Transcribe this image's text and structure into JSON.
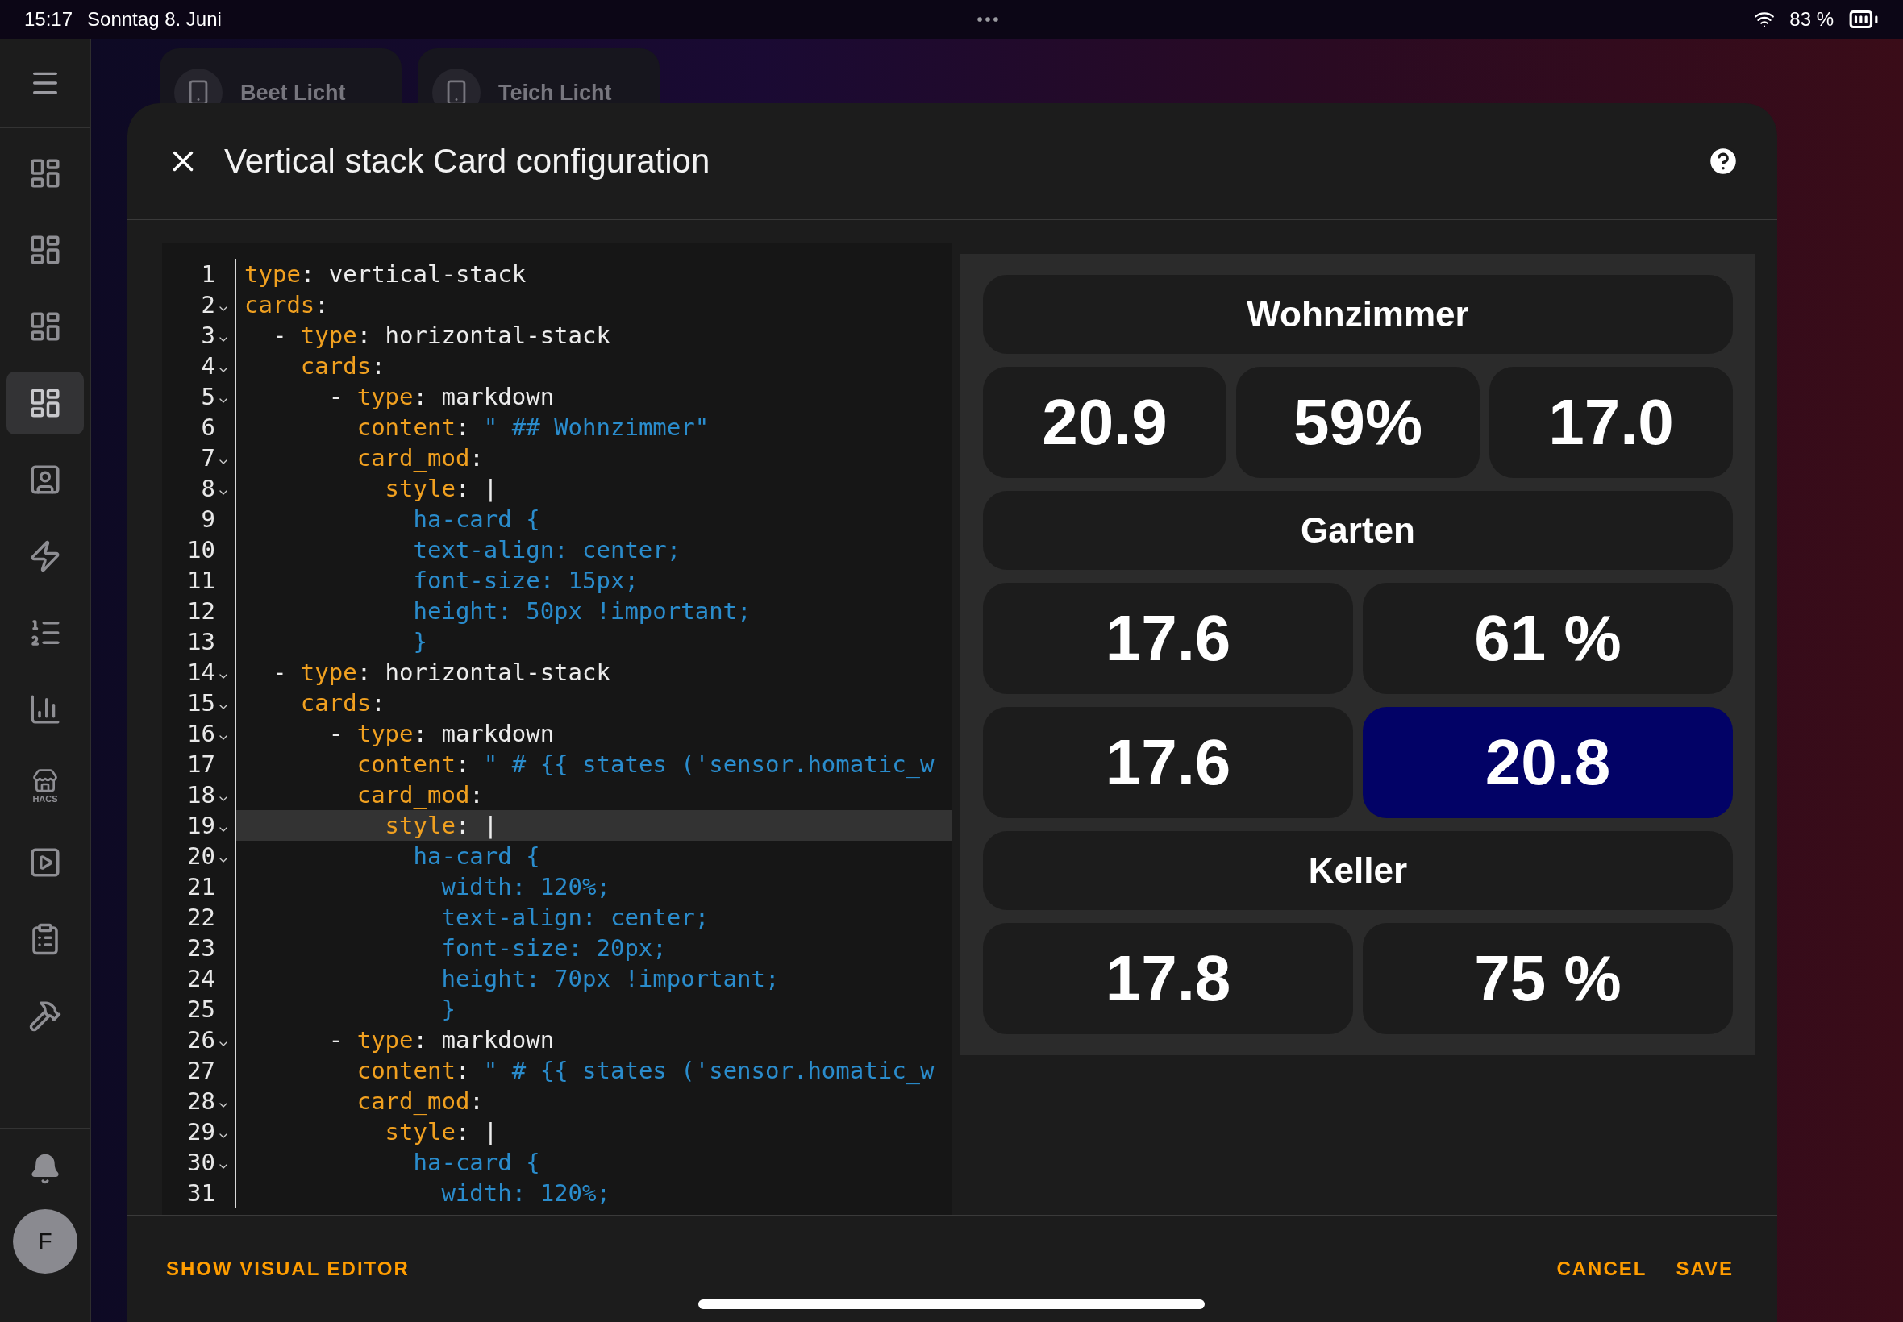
{
  "status_bar": {
    "time": "15:17",
    "date": "Sonntag 8. Juni",
    "battery": "83 %"
  },
  "sidebar": {
    "items": [
      {
        "selected": false
      },
      {
        "selected": false
      },
      {
        "selected": false
      },
      {
        "selected": true
      },
      {
        "selected": false
      },
      {
        "selected": false
      },
      {
        "selected": false
      },
      {
        "selected": false
      },
      {
        "selected": false,
        "label": "HACS"
      },
      {
        "selected": false
      },
      {
        "selected": false
      },
      {
        "selected": false
      }
    ],
    "avatar": "F"
  },
  "background": {
    "tiles": [
      {
        "label": "Beet Licht"
      },
      {
        "label": "Teich Licht"
      }
    ]
  },
  "dialog": {
    "title": "Vertical stack Card configuration",
    "editor": {
      "lines": [
        {
          "number": "1",
          "fold": false,
          "active": false,
          "tokens": [
            {
              "kind": "key",
              "text": "type"
            },
            {
              "kind": "plain",
              "text": ": vertical-stack"
            }
          ]
        },
        {
          "number": "2",
          "fold": true,
          "active": false,
          "tokens": [
            {
              "kind": "key",
              "text": "cards"
            },
            {
              "kind": "plain",
              "text": ":"
            }
          ]
        },
        {
          "number": "3",
          "fold": true,
          "active": false,
          "tokens": [
            {
              "kind": "plain",
              "text": "  - "
            },
            {
              "kind": "key",
              "text": "type"
            },
            {
              "kind": "plain",
              "text": ": horizontal-stack"
            }
          ]
        },
        {
          "number": "4",
          "fold": true,
          "active": false,
          "tokens": [
            {
              "kind": "key",
              "text": "    cards"
            },
            {
              "kind": "plain",
              "text": ":"
            }
          ]
        },
        {
          "number": "5",
          "fold": true,
          "active": false,
          "tokens": [
            {
              "kind": "plain",
              "text": "      - "
            },
            {
              "kind": "key",
              "text": "type"
            },
            {
              "kind": "plain",
              "text": ": markdown"
            }
          ]
        },
        {
          "number": "6",
          "fold": false,
          "active": false,
          "tokens": [
            {
              "kind": "key",
              "text": "        content"
            },
            {
              "kind": "plain",
              "text": ": "
            },
            {
              "kind": "string",
              "text": "\" ## Wohnzimmer\""
            }
          ]
        },
        {
          "number": "7",
          "fold": true,
          "active": false,
          "tokens": [
            {
              "kind": "key",
              "text": "        card_mod"
            },
            {
              "kind": "plain",
              "text": ":"
            }
          ]
        },
        {
          "number": "8",
          "fold": true,
          "active": false,
          "tokens": [
            {
              "kind": "key",
              "text": "          style"
            },
            {
              "kind": "plain",
              "text": ": |"
            }
          ]
        },
        {
          "number": "9",
          "fold": false,
          "active": false,
          "tokens": [
            {
              "kind": "string",
              "text": "            ha-card {"
            }
          ]
        },
        {
          "number": "10",
          "fold": false,
          "active": false,
          "tokens": [
            {
              "kind": "string",
              "text": "            text-align: center;"
            }
          ]
        },
        {
          "number": "11",
          "fold": false,
          "active": false,
          "tokens": [
            {
              "kind": "string",
              "text": "            font-size: 15px;"
            }
          ]
        },
        {
          "number": "12",
          "fold": false,
          "active": false,
          "tokens": [
            {
              "kind": "string",
              "text": "            height: 50px !important;"
            }
          ]
        },
        {
          "number": "13",
          "fold": false,
          "active": false,
          "tokens": [
            {
              "kind": "string",
              "text": "            }"
            }
          ]
        },
        {
          "number": "14",
          "fold": true,
          "active": false,
          "tokens": [
            {
              "kind": "plain",
              "text": "  - "
            },
            {
              "kind": "key",
              "text": "type"
            },
            {
              "kind": "plain",
              "text": ": horizontal-stack"
            }
          ]
        },
        {
          "number": "15",
          "fold": true,
          "active": false,
          "tokens": [
            {
              "kind": "key",
              "text": "    cards"
            },
            {
              "kind": "plain",
              "text": ":"
            }
          ]
        },
        {
          "number": "16",
          "fold": true,
          "active": false,
          "tokens": [
            {
              "kind": "plain",
              "text": "      - "
            },
            {
              "kind": "key",
              "text": "type"
            },
            {
              "kind": "plain",
              "text": ": markdown"
            }
          ]
        },
        {
          "number": "17",
          "fold": false,
          "active": false,
          "tokens": [
            {
              "kind": "key",
              "text": "        content"
            },
            {
              "kind": "plain",
              "text": ": "
            },
            {
              "kind": "string",
              "text": "\" # {{ states ('sensor.homatic_w"
            }
          ]
        },
        {
          "number": "18",
          "fold": true,
          "active": false,
          "tokens": [
            {
              "kind": "key",
              "text": "        card_mod"
            },
            {
              "kind": "plain",
              "text": ":"
            }
          ]
        },
        {
          "number": "19",
          "fold": true,
          "active": true,
          "tokens": [
            {
              "kind": "key",
              "text": "          style"
            },
            {
              "kind": "plain",
              "text": ": |"
            }
          ]
        },
        {
          "number": "20",
          "fold": true,
          "active": false,
          "tokens": [
            {
              "kind": "string",
              "text": "            ha-card {"
            }
          ]
        },
        {
          "number": "21",
          "fold": false,
          "active": false,
          "tokens": [
            {
              "kind": "string",
              "text": "              width: 120%;"
            }
          ]
        },
        {
          "number": "22",
          "fold": false,
          "active": false,
          "tokens": [
            {
              "kind": "string",
              "text": "              text-align: center;"
            }
          ]
        },
        {
          "number": "23",
          "fold": false,
          "active": false,
          "tokens": [
            {
              "kind": "string",
              "text": "              font-size: 20px;"
            }
          ]
        },
        {
          "number": "24",
          "fold": false,
          "active": false,
          "tokens": [
            {
              "kind": "string",
              "text": "              height: 70px !important;"
            }
          ]
        },
        {
          "number": "25",
          "fold": false,
          "active": false,
          "tokens": [
            {
              "kind": "string",
              "text": "              }"
            }
          ]
        },
        {
          "number": "26",
          "fold": true,
          "active": false,
          "tokens": [
            {
              "kind": "plain",
              "text": "      - "
            },
            {
              "kind": "key",
              "text": "type"
            },
            {
              "kind": "plain",
              "text": ": markdown"
            }
          ]
        },
        {
          "number": "27",
          "fold": false,
          "active": false,
          "tokens": [
            {
              "kind": "key",
              "text": "        content"
            },
            {
              "kind": "plain",
              "text": ": "
            },
            {
              "kind": "string",
              "text": "\" # {{ states ('sensor.homatic_w"
            }
          ]
        },
        {
          "number": "28",
          "fold": true,
          "active": false,
          "tokens": [
            {
              "kind": "key",
              "text": "        card_mod"
            },
            {
              "kind": "plain",
              "text": ":"
            }
          ]
        },
        {
          "number": "29",
          "fold": true,
          "active": false,
          "tokens": [
            {
              "kind": "key",
              "text": "          style"
            },
            {
              "kind": "plain",
              "text": ": |"
            }
          ]
        },
        {
          "number": "30",
          "fold": true,
          "active": false,
          "tokens": [
            {
              "kind": "string",
              "text": "            ha-card {"
            }
          ]
        },
        {
          "number": "31",
          "fold": false,
          "active": false,
          "tokens": [
            {
              "kind": "string",
              "text": "              width: 120%;"
            }
          ]
        }
      ]
    },
    "preview": {
      "rows": [
        {
          "kind": "title",
          "text": "Wohnzimmer"
        },
        {
          "kind": "values",
          "cells": [
            {
              "text": "20.9",
              "highlighted": false
            },
            {
              "text": "59%",
              "highlighted": false
            },
            {
              "text": "17.0",
              "highlighted": false
            }
          ]
        },
        {
          "kind": "title",
          "text": "Garten"
        },
        {
          "kind": "values",
          "cells": [
            {
              "text": "17.6",
              "highlighted": false
            },
            {
              "text": "61 %",
              "highlighted": false
            }
          ]
        },
        {
          "kind": "values",
          "cells": [
            {
              "text": "17.6",
              "highlighted": false
            },
            {
              "text": "20.8",
              "highlighted": true
            }
          ]
        },
        {
          "kind": "title",
          "text": "Keller"
        },
        {
          "kind": "values",
          "cells": [
            {
              "text": "17.8",
              "highlighted": false
            },
            {
              "text": "75 %",
              "highlighted": false
            }
          ]
        }
      ]
    },
    "buttons": {
      "left": "SHOW VISUAL EDITOR",
      "cancel": "CANCEL",
      "save": "SAVE"
    }
  }
}
